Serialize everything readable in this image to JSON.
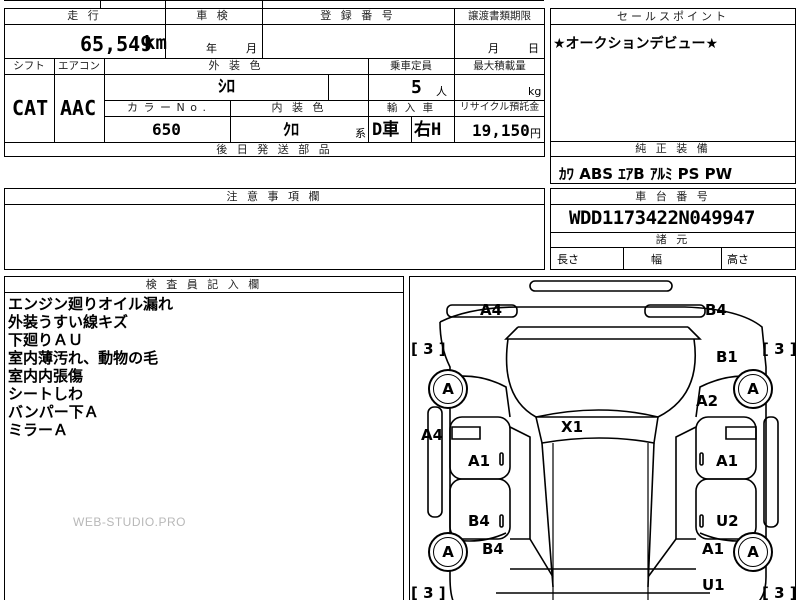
{
  "header": {
    "mileage_label": "走 行",
    "inspection_label": "車 検",
    "registration_label": "登 録 番 号",
    "transfer_doc_label": "譲渡書類期限",
    "selling_points_label": "セールスポイント"
  },
  "mileage": {
    "value": "65,549",
    "unit": "km"
  },
  "inspection": {
    "year_unit": "年",
    "month_unit": "月"
  },
  "transfer_doc": {
    "month_unit": "月",
    "day_unit": "日"
  },
  "selling_points": {
    "text": "★オークションデビュー★"
  },
  "row2": {
    "shift_label": "シフト",
    "aircon_label": "エアコン",
    "exterior_color_label": "外 装 色",
    "capacity_label": "乗車定員",
    "max_load_label": "最大積載量"
  },
  "shift": {
    "value": "CAT"
  },
  "aircon": {
    "value": "AAC"
  },
  "exterior_color": {
    "value": "ｼﾛ"
  },
  "capacity": {
    "value": "5",
    "unit": "人"
  },
  "max_load": {
    "unit": "kg"
  },
  "row3": {
    "color_no_label": "カ ラ ー  N o .",
    "interior_color_label": "内 装 色",
    "import_label": "輸 入 車",
    "recycle_label": "リサイクル預託金"
  },
  "color_no": {
    "value": "650"
  },
  "interior_color": {
    "value": "ｸﾛ",
    "suffix": "系"
  },
  "import": {
    "dealer": "D車",
    "steering": "右H"
  },
  "recycle": {
    "value": "19,150",
    "unit": "円"
  },
  "later_parts": {
    "label": "後 日 発 送 部 品"
  },
  "equipment": {
    "label": "純 正 装 備",
    "items": "ｶﾜ ABS ｴｱB ｱﾙﾐ PS PW"
  },
  "caution": {
    "label": "注 意 事 項 欄"
  },
  "chassis": {
    "label": "車 台 番 号",
    "value": "WDD1173422N049947"
  },
  "dimensions": {
    "label": "諸 元",
    "length": "長さ",
    "width": "幅",
    "height": "高さ"
  },
  "inspector": {
    "label": "検 査 員 記 入 欄",
    "notes": [
      "エンジン廻りオイル漏れ",
      "外装うすい線キズ",
      "下廻りＡＵ",
      "室内薄汚れ、動物の毛",
      "室内内張傷",
      "シートしわ",
      "バンパー下Ａ",
      "ミラーＡ"
    ]
  },
  "watermark": "WEB-STUDIO.PRO",
  "diagram": {
    "codes": {
      "a4_top": "A4",
      "b4_top": "B4",
      "b1": "B1",
      "a2": "A2",
      "x1": "X1",
      "a4_left": "A4",
      "a1_left": "A1",
      "a1_right": "A1",
      "b4_left": "B4",
      "u2": "U2",
      "b4_wheel": "B4",
      "a1_rear": "A1",
      "u1": "U1"
    },
    "tires": [
      "A",
      "A",
      "A",
      "A"
    ],
    "tire_brackets": [
      "[ 3 ]",
      "[ 3 ]",
      "[ 3 ]",
      "[ 3 ]"
    ]
  }
}
